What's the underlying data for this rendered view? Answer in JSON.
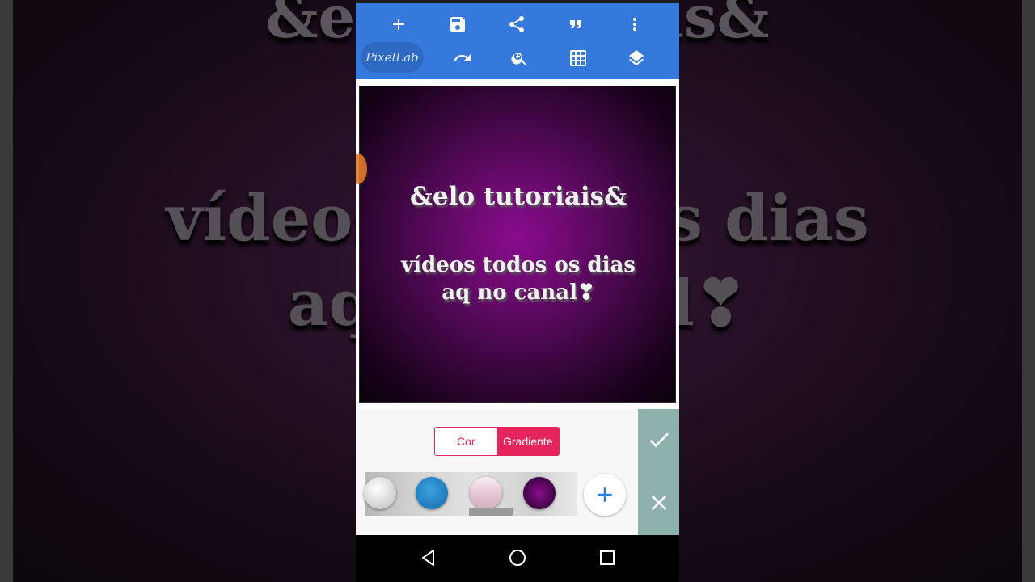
{
  "background": {
    "line1": "&elo tutoriais&",
    "line2": "vídeos todos os dias",
    "line3": "aq no canal❣"
  },
  "toolbar": {
    "logo_text": "PixelLab",
    "icons_row1": [
      "add-icon",
      "save-icon",
      "share-icon",
      "quote-icon",
      "more-vert-icon"
    ],
    "icons_row2": [
      "undo-icon",
      "zoom-in-icon",
      "grid-icon",
      "layers-icon"
    ],
    "color": "#3579dd"
  },
  "canvas": {
    "title": "&elo tutoriais&",
    "line1": "vídeos todos os dias",
    "line2": "aq no canal❣",
    "gradient_center": "#8a0c8e",
    "gradient_edge": "#0b010c"
  },
  "panel": {
    "tab_cor": "Cor",
    "tab_gradiente": "Gradiente",
    "selected_tab": "Gradiente",
    "accent": "#e5255c",
    "swatches": [
      "#e0e0e0",
      "#1b78b8",
      "#e2c0d0",
      "#5a0760"
    ]
  },
  "confirm": {
    "ok_icon": "check-icon",
    "cancel_icon": "close-icon",
    "color": "#8fb1ad"
  },
  "navbar": {
    "icons": [
      "back-icon",
      "home-icon",
      "recents-icon"
    ]
  }
}
